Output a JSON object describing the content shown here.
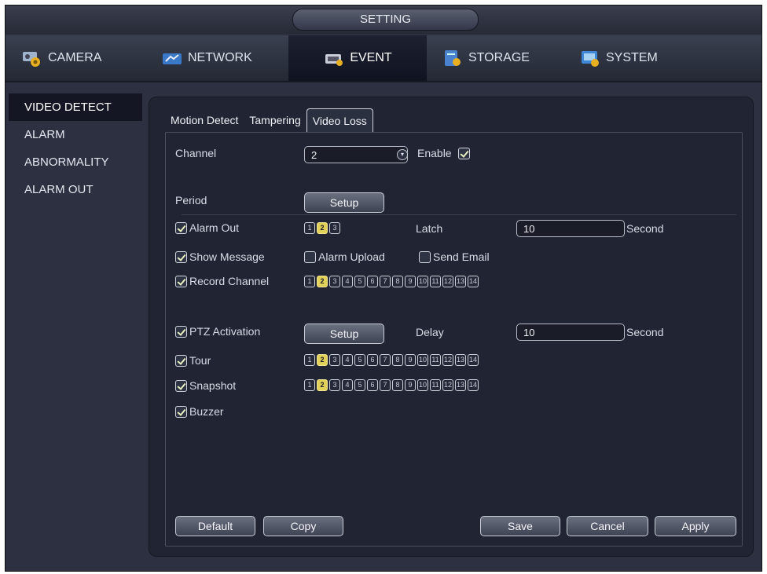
{
  "window": {
    "title": "SETTING"
  },
  "main_tabs": [
    {
      "label": "CAMERA",
      "icon": "camera-icon"
    },
    {
      "label": "NETWORK",
      "icon": "network-icon"
    },
    {
      "label": "EVENT",
      "icon": "event-icon",
      "active": true
    },
    {
      "label": "STORAGE",
      "icon": "storage-icon"
    },
    {
      "label": "SYSTEM",
      "icon": "system-icon"
    }
  ],
  "sidebar": {
    "items": [
      {
        "label": "VIDEO DETECT",
        "active": true
      },
      {
        "label": "ALARM"
      },
      {
        "label": "ABNORMALITY"
      },
      {
        "label": "ALARM OUT"
      }
    ]
  },
  "sub_tabs": [
    {
      "label": "Motion Detect"
    },
    {
      "label": "Tampering"
    },
    {
      "label": "Video Loss",
      "active": true
    }
  ],
  "form": {
    "channel_label": "Channel",
    "channel_value": "2",
    "enable_label": "Enable",
    "enable_checked": true,
    "period_label": "Period",
    "setup_label": "Setup",
    "alarm_out_label": "Alarm Out",
    "alarm_out_channels": [
      "1",
      "2",
      "3"
    ],
    "alarm_out_selected": "2",
    "latch_label": "Latch",
    "latch_value": "10",
    "latch_unit": "Second",
    "show_message_label": "Show Message",
    "alarm_upload_label": "Alarm Upload",
    "send_email_label": "Send Email",
    "record_channel_label": "Record Channel",
    "ptz_activation_label": "PTZ Activation",
    "ptz_setup_label": "Setup",
    "delay_label": "Delay",
    "delay_value": "10",
    "delay_unit": "Second",
    "tour_label": "Tour",
    "snapshot_label": "Snapshot",
    "buzzer_label": "Buzzer",
    "channel_numbers": [
      "1",
      "2",
      "3",
      "4",
      "5",
      "6",
      "7",
      "8",
      "9",
      "10",
      "11",
      "12",
      "13",
      "14"
    ],
    "selected_channel": "2"
  },
  "buttons": {
    "default": "Default",
    "copy": "Copy",
    "save": "Save",
    "cancel": "Cancel",
    "apply": "Apply"
  },
  "colors": {
    "accent_selected": "#e3d25a",
    "background": "#2c3040",
    "panel": "#212533"
  }
}
